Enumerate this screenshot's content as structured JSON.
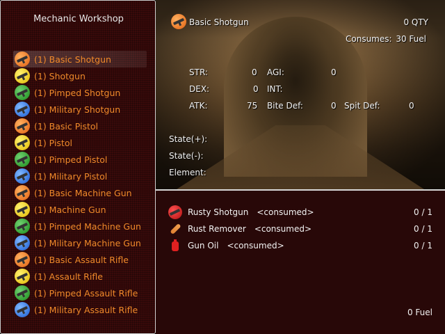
{
  "workshop": {
    "title": "Mechanic Workshop",
    "recipes": [
      {
        "label": "(1) Basic Shotgun",
        "color": "orange",
        "icon": "shotgun-icon",
        "selected": true
      },
      {
        "label": "(1) Shotgun",
        "color": "yellow",
        "icon": "shotgun-icon"
      },
      {
        "label": "(1) Pimped Shotgun",
        "color": "green",
        "icon": "shotgun-icon"
      },
      {
        "label": "(1) Military Shotgun",
        "color": "blue",
        "icon": "shotgun-icon"
      },
      {
        "label": "(1) Basic Pistol",
        "color": "orange",
        "icon": "pistol-icon"
      },
      {
        "label": "(1) Pistol",
        "color": "yellow",
        "icon": "pistol-icon"
      },
      {
        "label": "(1) Pimped Pistol",
        "color": "green",
        "icon": "pistol-icon"
      },
      {
        "label": "(1) Military Pistol",
        "color": "blue",
        "icon": "pistol-icon"
      },
      {
        "label": "(1) Basic Machine Gun",
        "color": "orange",
        "icon": "machine-gun-icon"
      },
      {
        "label": "(1) Machine Gun",
        "color": "yellow",
        "icon": "machine-gun-icon"
      },
      {
        "label": "(1) Pimped Machine Gun",
        "color": "green",
        "icon": "machine-gun-icon"
      },
      {
        "label": "(1) Military Machine Gun",
        "color": "blue",
        "icon": "machine-gun-icon"
      },
      {
        "label": "(1) Basic Assault Rifle",
        "color": "orange",
        "icon": "assault-rifle-icon"
      },
      {
        "label": "(1) Assault Rifle",
        "color": "yellow",
        "icon": "assault-rifle-icon"
      },
      {
        "label": "(1) Pimped Assault Rifle",
        "color": "green",
        "icon": "assault-rifle-icon"
      },
      {
        "label": "(1) Military Assault Rifle",
        "color": "blue",
        "icon": "assault-rifle-icon"
      }
    ]
  },
  "info": {
    "item_name": "Basic Shotgun",
    "qty": "0 QTY",
    "consumes_label": "Consumes:",
    "consumes_value": "30 Fuel",
    "str_label": "STR:",
    "str_value": "0",
    "agi_label": "AGI:",
    "agi_value": "0",
    "dex_label": "DEX:",
    "dex_value": "0",
    "int_label": "INT:",
    "atk_label": "ATK:",
    "atk_value": "75",
    "bite_def_label": "Bite Def:",
    "bite_def_value": "0",
    "spit_def_label": "Spit Def:",
    "spit_def_value": "0",
    "state_plus_label": "State(+):",
    "state_minus_label": "State(-):",
    "element_label": "Element:"
  },
  "ingredients": [
    {
      "name": "Rusty Shotgun",
      "tag": "<consumed>",
      "count": "0 / 1",
      "icon": "rusty-shotgun-icon"
    },
    {
      "name": "Rust Remover",
      "tag": "<consumed>",
      "count": "0 / 1",
      "icon": "rust-remover-icon"
    },
    {
      "name": "Gun Oil",
      "tag": "<consumed>",
      "count": "0 / 1",
      "icon": "gun-oil-icon"
    }
  ],
  "fuel_total": "0 Fuel",
  "colors": {
    "recipe_text": "#f08a2a",
    "panel_bg": "#3a0a0a"
  }
}
